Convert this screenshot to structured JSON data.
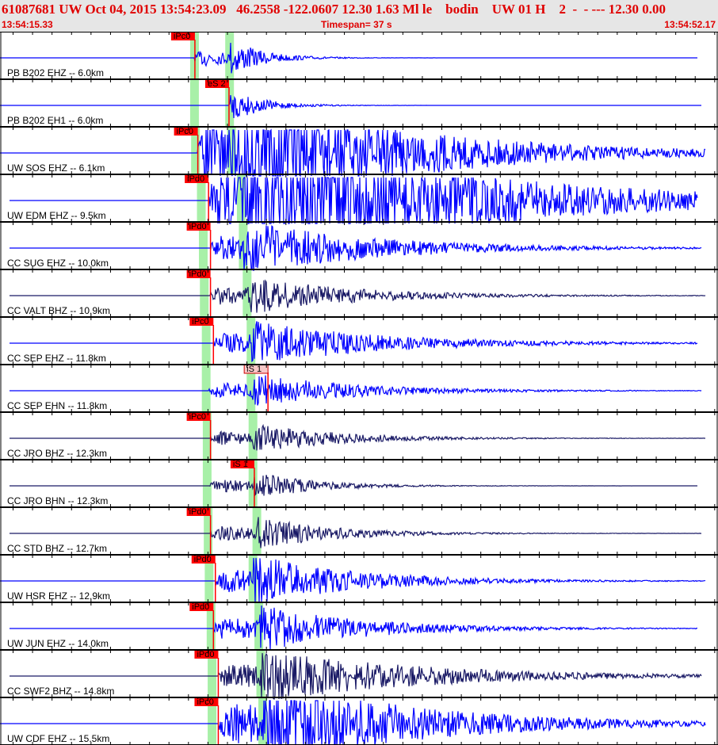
{
  "header": {
    "title": "61087681 UW Oct 04, 2015 13:54:23.09   46.2558 -122.0607 12.30 1.63 Ml le    bodin    UW 01 H    2  -  - --- 12.30 0.00",
    "start_time": "13:54:15.33",
    "timespan": "Timespan=  37 s",
    "end_time": "13:54:52.17"
  },
  "timespan_s": 36.84,
  "colors": {
    "blue": "#0000ff",
    "navy": "#1a1a66",
    "pick": "#ff0000",
    "band": "#a8f0a8"
  },
  "traces": [
    {
      "label": "PB B202 EHZ -- 6.0km",
      "color": "blue",
      "p": 10.0,
      "s": 11.8,
      "pick": {
        "label": "iPc0",
        "t": 10.0
      },
      "amp": 0.5,
      "dec": 0.45
    },
    {
      "label": "PB B202 EH1 -- 6.0km",
      "color": "blue",
      "p": 10.0,
      "s": 11.8,
      "pick": {
        "label": "eS 2",
        "t": 11.75
      },
      "amp": 0.35,
      "dec": 0.5
    },
    {
      "label": "UW SOS EHZ -- 6.1km",
      "color": "blue",
      "p": 10.05,
      "s": 11.9,
      "pick": {
        "label": "iPc0",
        "t": 10.15
      },
      "amp": 1.6,
      "dec": 0.1
    },
    {
      "label": "UW EDM EHZ -- 9.5km",
      "color": "blue",
      "p": 10.35,
      "s": 12.4,
      "pick": {
        "label": "iPd0",
        "t": 10.7
      },
      "amp": 1.5,
      "dec": 0.07
    },
    {
      "label": "CC SUG EHZ -- 10.0km",
      "color": "blue",
      "p": 10.45,
      "s": 12.5,
      "pick": {
        "label": "iPd0",
        "t": 10.8
      },
      "amp": 0.6,
      "dec": 0.12
    },
    {
      "label": "CC VALT BHZ -- 10.9km",
      "color": "navy",
      "p": 10.5,
      "s": 12.7,
      "pick": {
        "label": "iPd0",
        "t": 10.8
      },
      "amp": 0.45,
      "dec": 0.15
    },
    {
      "label": "CC SEP EHZ -- 11.8km",
      "color": "blue",
      "p": 10.6,
      "s": 12.9,
      "pick": {
        "label": "iPc0",
        "t": 10.95
      },
      "amp": 0.5,
      "dec": 0.12
    },
    {
      "label": "CC SEP EHN -- 11.8km",
      "color": "blue",
      "p": 10.6,
      "s": 12.9,
      "pick": {
        "label": "iS 1",
        "t": 13.75,
        "light": true
      },
      "amp": 0.4,
      "dec": 0.15
    },
    {
      "label": "CC JRO BHZ -- 12.3km",
      "color": "navy",
      "p": 10.65,
      "s": 13.0,
      "pick": {
        "label": "iPc0",
        "t": 10.8
      },
      "amp": 0.35,
      "dec": 0.18
    },
    {
      "label": "CC JRO BHN -- 12.3km",
      "color": "navy",
      "p": 10.65,
      "s": 13.0,
      "pick": {
        "label": "iS 1",
        "t": 13.05
      },
      "amp": 0.35,
      "dec": 0.25
    },
    {
      "label": "CC STD BHZ -- 12.7km",
      "color": "navy",
      "p": 10.7,
      "s": 13.2,
      "pick": {
        "label": "iPd0",
        "t": 10.8
      },
      "amp": 0.4,
      "dec": 0.2
    },
    {
      "label": "UW HSR EHZ -- 12.9km",
      "color": "blue",
      "p": 10.75,
      "s": 13.0,
      "pick": {
        "label": "iPd0",
        "t": 11.05
      },
      "amp": 0.6,
      "dec": 0.15
    },
    {
      "label": "UW JUN EHZ -- 14.0km",
      "color": "blue",
      "p": 10.85,
      "s": 13.3,
      "pick": {
        "label": "iPd0",
        "t": 10.95
      },
      "amp": 0.55,
      "dec": 0.15
    },
    {
      "label": "CC SWF2 BHZ -- 14.8km",
      "color": "navy",
      "p": 10.9,
      "s": 13.4,
      "pick": {
        "label": "iPd0",
        "t": 11.2
      },
      "amp": 0.6,
      "dec": 0.1
    },
    {
      "label": "UW CDF EHZ -- 15.5km",
      "color": "blue",
      "p": 10.9,
      "s": 13.5,
      "pick": {
        "label": "iPc0",
        "t": 11.2
      },
      "amp": 1.0,
      "dec": 0.1
    }
  ]
}
